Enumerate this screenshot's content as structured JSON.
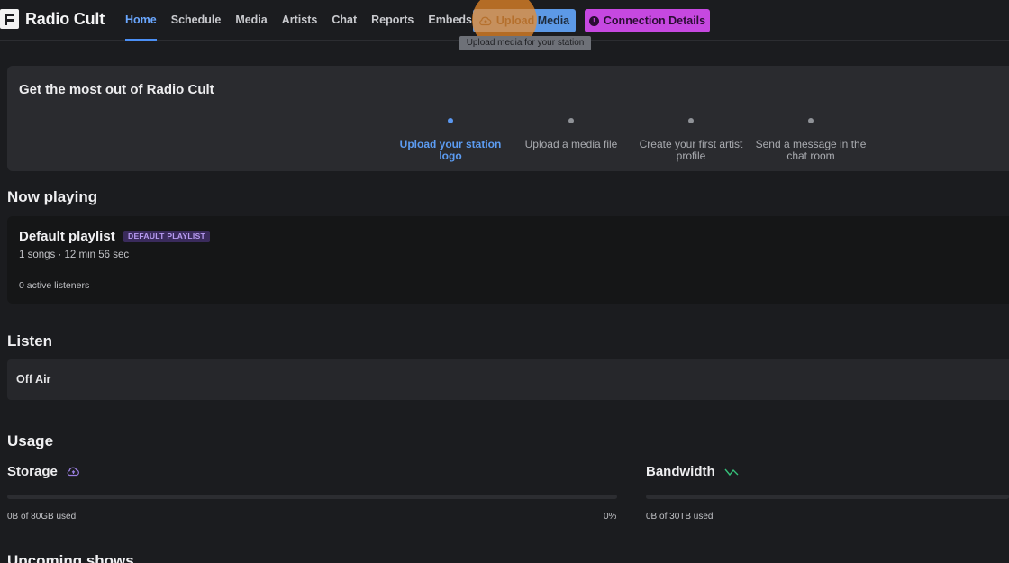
{
  "app": {
    "name": "Radio Cult"
  },
  "nav": {
    "items": [
      {
        "label": "Home",
        "active": true
      },
      {
        "label": "Schedule"
      },
      {
        "label": "Media"
      },
      {
        "label": "Artists"
      },
      {
        "label": "Chat"
      },
      {
        "label": "Reports"
      },
      {
        "label": "Embeds"
      }
    ],
    "upload_button": "Upload Media",
    "connection_button": "Connection Details",
    "tooltip": "Upload media for your station"
  },
  "onboarding": {
    "title": "Get the most out of Radio Cult",
    "steps": [
      {
        "label": "Upload your station logo",
        "active": true
      },
      {
        "label": "Upload a media file"
      },
      {
        "label": "Create your first artist profile"
      },
      {
        "label": "Send a message in the chat room"
      }
    ]
  },
  "now_playing": {
    "heading": "Now playing",
    "playlist_name": "Default playlist",
    "badge": "DEFAULT PLAYLIST",
    "meta": "1 songs · 12 min 56 sec",
    "listeners": "0 active listeners"
  },
  "listen": {
    "heading": "Listen",
    "status": "Off Air"
  },
  "usage": {
    "heading": "Usage",
    "storage": {
      "label": "Storage",
      "used_text": "0B of 80GB used",
      "percent_text": "0%",
      "fraction": 0
    },
    "bandwidth": {
      "label": "Bandwidth",
      "used_text": "0B of 30TB used"
    }
  },
  "upcoming": {
    "heading": "Upcoming shows"
  },
  "colors": {
    "accent": "#4b8ff5",
    "upload": "#5c99e6",
    "connection": "#c648e0",
    "badge": "#3a2b5c"
  }
}
